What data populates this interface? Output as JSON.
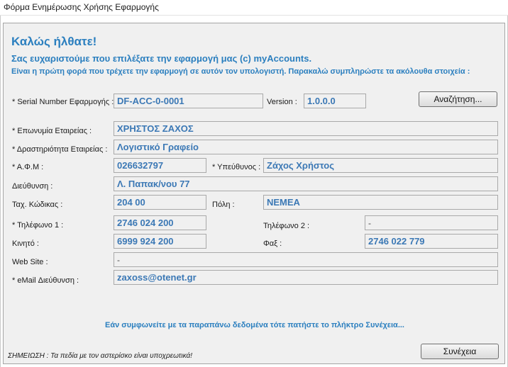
{
  "window": {
    "title": "Φόρμα Ενημέρωσης Χρήσης Εφαρμογής"
  },
  "header": {
    "welcome": "Καλώς ήλθατε!",
    "thanks": "Σας ευχαριστούμε που επιλέξατε την εφαρμογή μας  (c) myAccounts.",
    "first_run": "Είναι η πρώτη φορά που τρέχετε την εφαρμογή σε αυτόν τον υπολογιστή. Παρακαλώ συμπληρώστε τα ακόλουθα στοιχεία :"
  },
  "form": {
    "serial": {
      "label": "* Serial Number Εφαρμογής  :",
      "value": "DF-ACC-0-0001"
    },
    "version": {
      "label": "Version  :",
      "value": "1.0.0.0"
    },
    "search_button": "Αναζήτηση...",
    "company": {
      "label": "* Επωνυμία Εταιρείας :",
      "value": "ΧΡΗΣΤΟΣ ΖΑΧΟΣ"
    },
    "activity": {
      "label": "* Δραστηριότητα Εταιρείας :",
      "value": "Λογιστικό Γραφείο"
    },
    "afm": {
      "label": "* Α.Φ.Μ :",
      "value": "026632797"
    },
    "manager": {
      "label": "* Υπεύθυνος :",
      "value": "Ζάχος Χρήστος"
    },
    "address": {
      "label": "Διεύθυνση :",
      "value": "Λ. Παπακ/νου 77"
    },
    "zip": {
      "label": "Ταχ. Κώδικας :",
      "value": "204 00"
    },
    "city": {
      "label": "Πόλη :",
      "value": "ΝΕΜΕΑ"
    },
    "phone1": {
      "label": "* Τηλέφωνο 1 :",
      "value": "2746 024 200"
    },
    "phone2": {
      "label": "Τηλέφωνο 2 :",
      "value": "-"
    },
    "mobile": {
      "label": "Κινητό :",
      "value": "6999 924 200"
    },
    "fax": {
      "label": "Φαξ :",
      "value": "2746 022 779"
    },
    "website": {
      "label": "Web Site :",
      "value": "-"
    },
    "email": {
      "label": "* eMail Διεύθυνση :",
      "value": "zaxoss@otenet.gr"
    }
  },
  "footer": {
    "confirm_text": "Εάν συμφωνείτε με τα παραπάνω δεδομένα τότε πατήστε το πλήκτρο Συνέχεια...",
    "note": "ΣΗΜΕΙΩΣΗ : Τα πεδία με τον αστερίσκο είναι υποχρεωτικά!",
    "continue_button": "Συνέχεια"
  }
}
